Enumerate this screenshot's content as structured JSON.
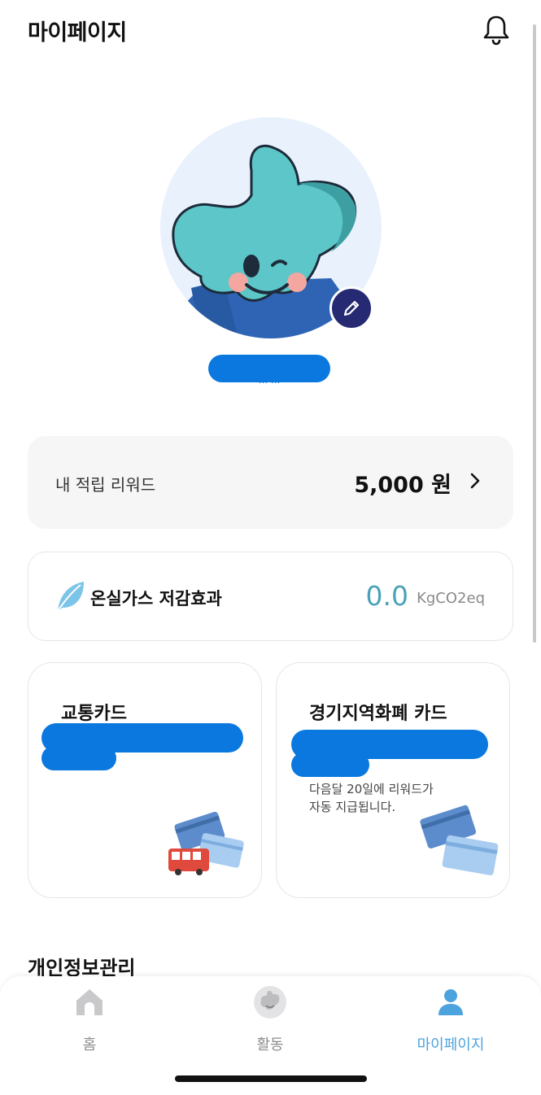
{
  "header": {
    "title": "마이페이지",
    "bell_icon": "bell-icon"
  },
  "profile": {
    "edit_icon": "pencil-icon",
    "nickname_redacted_fragment": "... ..."
  },
  "reward": {
    "label": "내 적립 리워드",
    "amount": "5,000 원",
    "arrow_icon": "chevron-right-icon"
  },
  "ghg": {
    "icon": "leaf-icon",
    "label": "온실가스 저감효과",
    "value": "0.0",
    "unit": "KgCO2eq",
    "value_color": "#4aa2b8"
  },
  "cards": {
    "transit": {
      "title": "교통카드"
    },
    "local_currency": {
      "title": "경기지역화폐 카드",
      "note_line1": "다음달 20일에 리워드가",
      "note_line2": "자동 지급됩니다."
    }
  },
  "section": {
    "title": "개인정보관리"
  },
  "tabbar": {
    "items": [
      {
        "label": "홈",
        "icon": "home-icon",
        "active": false
      },
      {
        "label": "활동",
        "icon": "activity-mascot-icon",
        "active": false
      },
      {
        "label": "마이페이지",
        "icon": "person-icon",
        "active": true
      }
    ],
    "active_color": "#4da3de"
  },
  "colors": {
    "redaction": "#0a78df",
    "edit_button": "#252a72",
    "profile_bg": "#e9f2fc"
  }
}
